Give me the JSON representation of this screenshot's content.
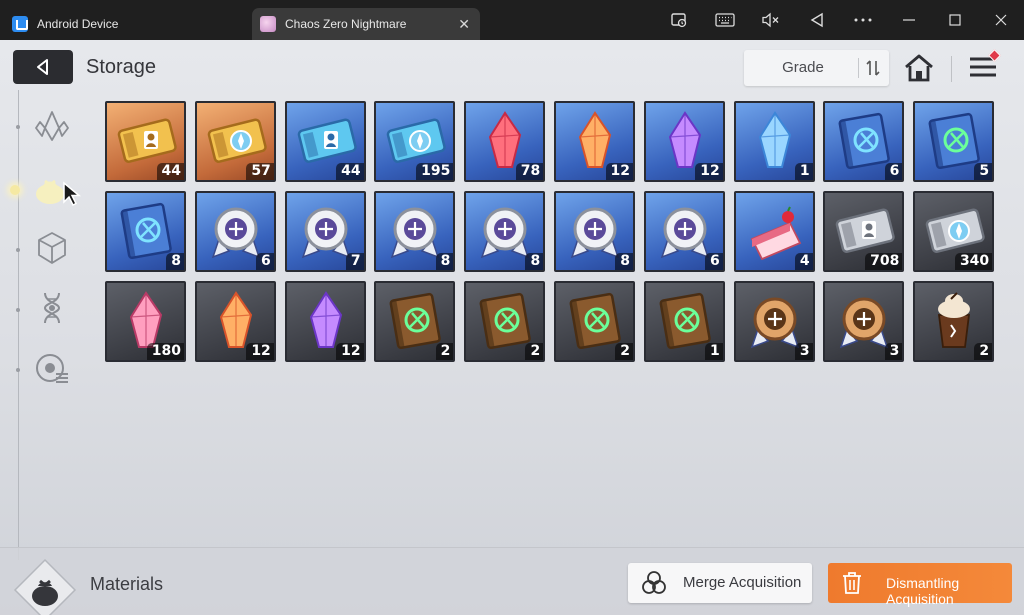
{
  "window": {
    "tabs": [
      {
        "label": "Android Device",
        "icon": "android-device-icon"
      },
      {
        "label": "Chaos Zero Nightmare",
        "icon": "game-icon"
      }
    ],
    "toolbar_icons": [
      "screen-record-icon",
      "keyboard-icon",
      "mute-icon",
      "back-icon",
      "more-icon",
      "minimize-icon",
      "maximize-icon",
      "close-icon"
    ]
  },
  "header": {
    "title": "Storage",
    "sort_label": "Grade"
  },
  "categories": [
    {
      "name": "crystal-category-icon",
      "active": false
    },
    {
      "name": "materials-category-icon",
      "active": true
    },
    {
      "name": "cube-category-icon",
      "active": false
    },
    {
      "name": "dna-category-icon",
      "active": false
    },
    {
      "name": "chip-category-icon",
      "active": false
    }
  ],
  "items": [
    {
      "icon": "gold-ticket-icon",
      "rarity": "gold",
      "count": "44"
    },
    {
      "icon": "gold-compass-ticket-icon",
      "rarity": "gold",
      "count": "57"
    },
    {
      "icon": "blue-ticket-icon",
      "rarity": "blue",
      "count": "44"
    },
    {
      "icon": "blue-compass-ticket-icon",
      "rarity": "blue",
      "count": "195"
    },
    {
      "icon": "red-crystal-icon",
      "rarity": "blue",
      "count": "78"
    },
    {
      "icon": "orange-crystal-icon",
      "rarity": "blue",
      "count": "12"
    },
    {
      "icon": "purple-crystal-icon",
      "rarity": "blue",
      "count": "12"
    },
    {
      "icon": "blue-crystal-icon",
      "rarity": "blue",
      "count": "1"
    },
    {
      "icon": "blue-book-icon",
      "rarity": "blue",
      "count": "6"
    },
    {
      "icon": "blue-book-green-icon",
      "rarity": "blue",
      "count": "5"
    },
    {
      "icon": "blue-book-lightning-icon",
      "rarity": "blue",
      "count": "8"
    },
    {
      "icon": "silver-medal-icon",
      "rarity": "blue",
      "count": "6"
    },
    {
      "icon": "silver-medal-shield-icon",
      "rarity": "blue",
      "count": "7"
    },
    {
      "icon": "silver-medal-core-icon",
      "rarity": "blue",
      "count": "8"
    },
    {
      "icon": "silver-medal-sword-icon",
      "rarity": "blue",
      "count": "8"
    },
    {
      "icon": "silver-medal-bolt-icon",
      "rarity": "blue",
      "count": "8"
    },
    {
      "icon": "silver-medal-orb-icon",
      "rarity": "blue",
      "count": "6"
    },
    {
      "icon": "cake-icon",
      "rarity": "blue",
      "count": "4"
    },
    {
      "icon": "silver-ticket-icon",
      "rarity": "grey",
      "count": "708"
    },
    {
      "icon": "silver-compass-ticket-icon",
      "rarity": "grey",
      "count": "340"
    },
    {
      "icon": "pink-shard-icon",
      "rarity": "grey",
      "count": "180"
    },
    {
      "icon": "orange-shard-icon",
      "rarity": "grey",
      "count": "12"
    },
    {
      "icon": "purple-shard-icon",
      "rarity": "grey",
      "count": "12"
    },
    {
      "icon": "brown-book-sword-icon",
      "rarity": "grey",
      "count": "2"
    },
    {
      "icon": "brown-book-shield-icon",
      "rarity": "grey",
      "count": "2"
    },
    {
      "icon": "brown-book-target-icon",
      "rarity": "grey",
      "count": "2"
    },
    {
      "icon": "brown-book-wings-icon",
      "rarity": "grey",
      "count": "1"
    },
    {
      "icon": "bronze-medal-icon",
      "rarity": "grey",
      "count": "3"
    },
    {
      "icon": "bronze-medal-bolt-icon",
      "rarity": "grey",
      "count": "3"
    },
    {
      "icon": "coffee-icon",
      "rarity": "grey",
      "count": "2"
    }
  ],
  "footer": {
    "section_label": "Materials",
    "merge_label": "Merge Acquisition",
    "dismantle_label": "Dismantling Acquisition"
  },
  "colors": {
    "accent_orange": "#f08030",
    "rarity_gold": "#d9874e",
    "rarity_blue": "#3e6cc7",
    "rarity_grey": "#45474e"
  }
}
